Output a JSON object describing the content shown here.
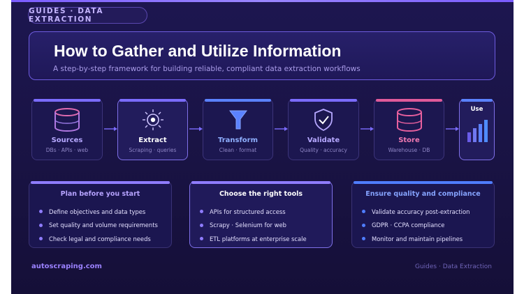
{
  "badge": "GUIDES · DATA EXTRACTION",
  "hero": {
    "title": "How to Gather and Utilize Information",
    "subtitle": "A step-by-step framework for building reliable, compliant data extraction workflows"
  },
  "steps": [
    {
      "title": "Sources",
      "subtitle": "DBs · APIs · web",
      "icon": "database-icon",
      "accent": "#7b6cff"
    },
    {
      "title": "Extract",
      "subtitle": "Scraping · queries",
      "icon": "sparkle-icon",
      "accent": "#7b6cff"
    },
    {
      "title": "Transform",
      "subtitle": "Clean · format",
      "icon": "funnel-icon",
      "accent": "#5b82ff"
    },
    {
      "title": "Validate",
      "subtitle": "Quality · accuracy",
      "icon": "shield-check-icon",
      "accent": "#7b6cff"
    },
    {
      "title": "Store",
      "subtitle": "Warehouse · DB",
      "icon": "database-icon",
      "accent": "#e05a9a"
    },
    {
      "title": "Use",
      "subtitle": "",
      "icon": "bar-chart-icon",
      "accent": "#5b82ff"
    }
  ],
  "cards": [
    {
      "title": "Plan before you start",
      "accent": "#8f7cff",
      "items": [
        "Define objectives and data types",
        "Set quality and volume requirements",
        "Check legal and compliance needs"
      ]
    },
    {
      "title": "Choose the right tools",
      "accent": "#8f7cff",
      "items": [
        "APIs for structured access",
        "Scrapy · Selenium for web",
        "ETL platforms at enterprise scale"
      ]
    },
    {
      "title": "Ensure quality and compliance",
      "accent": "#4f7dff",
      "items": [
        "Validate accuracy post-extraction",
        "GDPR · CCPA compliance",
        "Monitor and maintain pipelines"
      ]
    }
  ],
  "footer": {
    "left": "autoscraping.com",
    "right": "Guides · Data Extraction"
  }
}
